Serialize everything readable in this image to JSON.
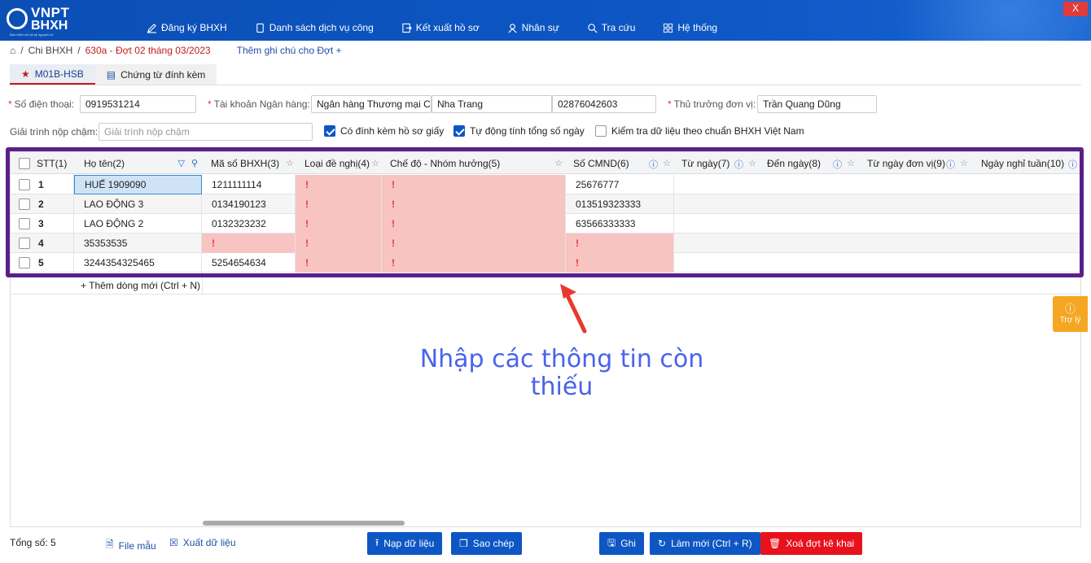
{
  "brand": {
    "logo_top": "VNPT",
    "logo_bottom": "BHXH",
    "tagline": "Bảo hiểm xã hội kỹ nguyên số"
  },
  "nav": [
    {
      "label": "Đăng ký BHXH",
      "icon": "pen-icon"
    },
    {
      "label": "Danh sách dịch vụ công",
      "icon": "document-icon"
    },
    {
      "label": "Kết xuất hồ sơ",
      "icon": "export-icon"
    },
    {
      "label": "Nhân sự",
      "icon": "users-icon"
    },
    {
      "label": "Tra cứu",
      "icon": "search-icon"
    },
    {
      "label": "Hệ thống",
      "icon": "grid-icon"
    }
  ],
  "window": {
    "close": "X"
  },
  "breadcrumb": {
    "home": "⌂",
    "sep": "/",
    "level1": "Chi BHXH",
    "current": "630a - Đợt 02 tháng 03/2023",
    "note": "Thêm ghi chú cho Đợt",
    "plus": "+"
  },
  "tabs": [
    {
      "label": "M01B-HSB",
      "icon": "star-icon"
    },
    {
      "label": "Chứng từ đính kèm",
      "icon": "list-icon"
    }
  ],
  "form": {
    "phone_label": "Số điện thoại",
    "phone_value": "0919531214",
    "bank_label": "Tài khoản Ngân hàng",
    "bank_name": "Ngân hàng Thương mại Cổ",
    "bank_branch": "Nha Trang",
    "bank_account": "02876042603",
    "head_label": "Thủ trưởng đơn vị",
    "head_value": "Trần Quang Dũng",
    "late_label": "Giải trình nộp chậm",
    "late_placeholder": "Giải trình nộp chậm",
    "cb1": "Có đính kèm hồ sơ giấy",
    "cb2": "Tự động tính tổng số ngày",
    "cb3": "Kiểm tra dữ liệu theo chuẩn BHXH Việt Nam"
  },
  "grid": {
    "headers": [
      "STT(1)",
      "Họ tên(2)",
      "Mã số BHXH(3)",
      "Loại đề nghị(4)",
      "Chế độ - Nhóm hưởng(5)",
      "Số CMND(6)",
      "Từ ngày(7)",
      "Đến ngày(8)",
      "Từ ngày đơn vị(9)",
      "Ngày nghỉ tuần(10)"
    ],
    "rows": [
      {
        "stt": "1",
        "name": "HUẾ 1909090",
        "bhxh": "1211111114",
        "loai": "!",
        "chedo": "!",
        "cmnd": "25676777"
      },
      {
        "stt": "2",
        "name": "LAO ĐỘNG 3",
        "bhxh": "0134190123",
        "loai": "!",
        "chedo": "!",
        "cmnd": "013519323333"
      },
      {
        "stt": "3",
        "name": "LAO ĐỘNG 2",
        "bhxh": "0132323232",
        "loai": "!",
        "chedo": "!",
        "cmnd": "63566333333"
      },
      {
        "stt": "4",
        "name": "35353535",
        "bhxh": "!",
        "loai": "!",
        "chedo": "!",
        "cmnd": "!"
      },
      {
        "stt": "5",
        "name": "3244354325465",
        "bhxh": "5254654634",
        "loai": "!",
        "chedo": "!",
        "cmnd": "!"
      }
    ],
    "add_row": "+ Thêm dòng mới (Ctrl + N)"
  },
  "annotation": {
    "line1": "Nhập các thông tin còn",
    "line2": "thiếu"
  },
  "assistant": {
    "label": "Trợ lý",
    "icon": "info-icon"
  },
  "footer": {
    "total": "Tổng số: 5",
    "template": "File mẫu",
    "export": "Xuất dữ liệu",
    "load": "Nạp dữ liệu",
    "copy": "Sao chép",
    "save": "Ghi",
    "reset": "Làm mới (Ctrl + R)",
    "delete": "Xoá đợt kê khai"
  },
  "colors": {
    "brand": "#0d56c4",
    "error_cell": "#f8c4c2",
    "highlight": "#5b1f8a",
    "delete": "#e8121c",
    "assist": "#f5a623"
  }
}
